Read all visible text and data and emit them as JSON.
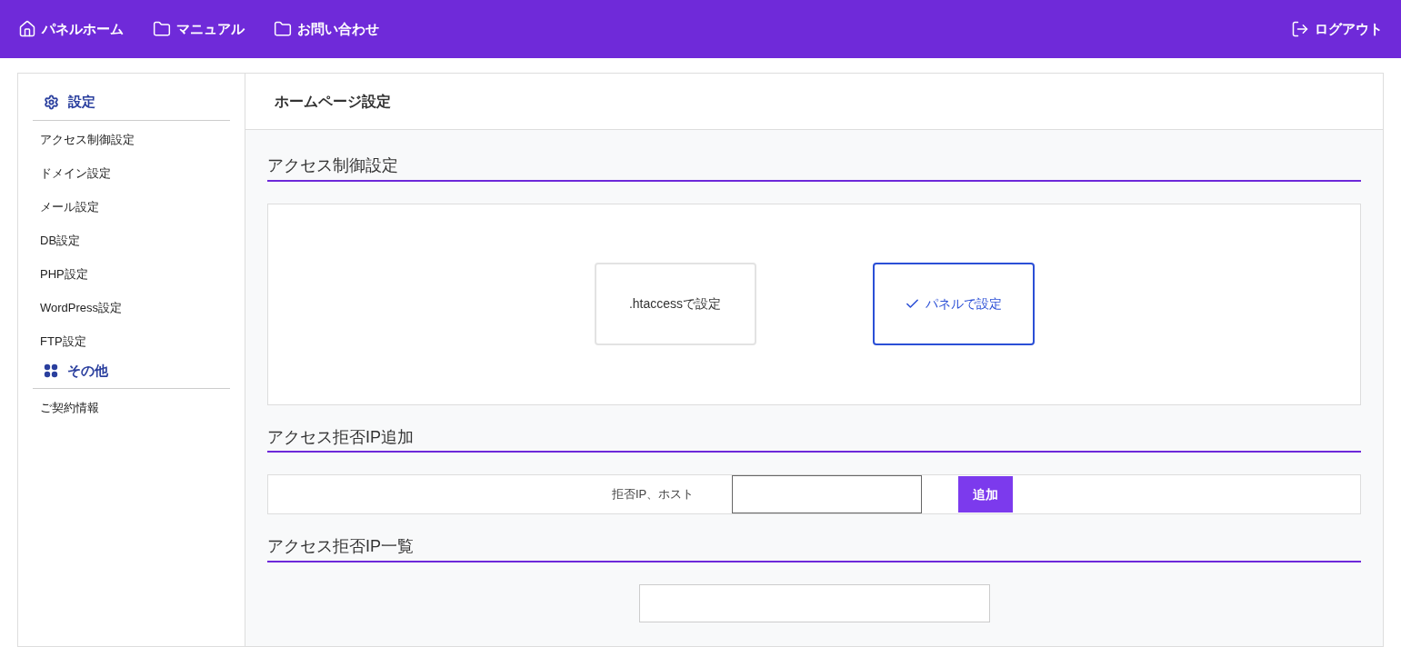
{
  "nav": {
    "items": [
      {
        "label": "パネルホーム",
        "kind": "home"
      },
      {
        "label": "マニュアル",
        "kind": "folder"
      },
      {
        "label": "お問い合わせ",
        "kind": "folder"
      }
    ],
    "logout": "ログアウト"
  },
  "sidebar": [
    {
      "title": "設定",
      "kind": "gear",
      "items": [
        "アクセス制御設定",
        "ドメイン設定",
        "メール設定",
        "DB設定",
        "PHP設定",
        "WordPress設定",
        "FTP設定"
      ]
    },
    {
      "title": "その他",
      "kind": "grid",
      "items": [
        "ご契約情報"
      ]
    }
  ],
  "page_title": "ホームページ設定",
  "access_control": {
    "heading": "アクセス制御設定",
    "options": [
      {
        "label": ".htaccessで設定",
        "selected": false
      },
      {
        "label": "パネルで設定",
        "selected": true
      }
    ]
  },
  "deny_add": {
    "heading": "アクセス拒否IP追加",
    "label": "拒否IP、ホスト",
    "button": "追加"
  },
  "deny_list": {
    "heading": "アクセス拒否IP一覧"
  }
}
